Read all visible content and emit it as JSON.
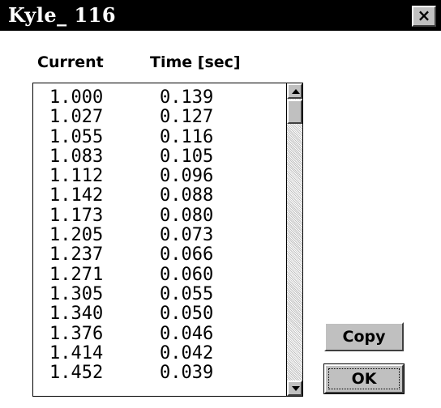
{
  "window": {
    "title": "Kyle_ 116",
    "close_label": "×"
  },
  "table": {
    "headers": [
      "Current",
      "Time [sec]"
    ],
    "rows": [
      [
        "1.000",
        "0.139"
      ],
      [
        "1.027",
        "0.127"
      ],
      [
        "1.055",
        "0.116"
      ],
      [
        "1.083",
        "0.105"
      ],
      [
        "1.112",
        "0.096"
      ],
      [
        "1.142",
        "0.088"
      ],
      [
        "1.173",
        "0.080"
      ],
      [
        "1.205",
        "0.073"
      ],
      [
        "1.237",
        "0.066"
      ],
      [
        "1.271",
        "0.060"
      ],
      [
        "1.305",
        "0.055"
      ],
      [
        "1.340",
        "0.050"
      ],
      [
        "1.376",
        "0.046"
      ],
      [
        "1.414",
        "0.042"
      ],
      [
        "1.452",
        "0.039"
      ]
    ]
  },
  "buttons": {
    "copy": "Copy",
    "ok": "OK"
  },
  "icons": {
    "close": "close-icon",
    "scroll_up": "arrow-up-icon",
    "scroll_down": "arrow-down-icon"
  },
  "colors": {
    "titlebar": "#000000",
    "face": "#c0c0c0"
  }
}
